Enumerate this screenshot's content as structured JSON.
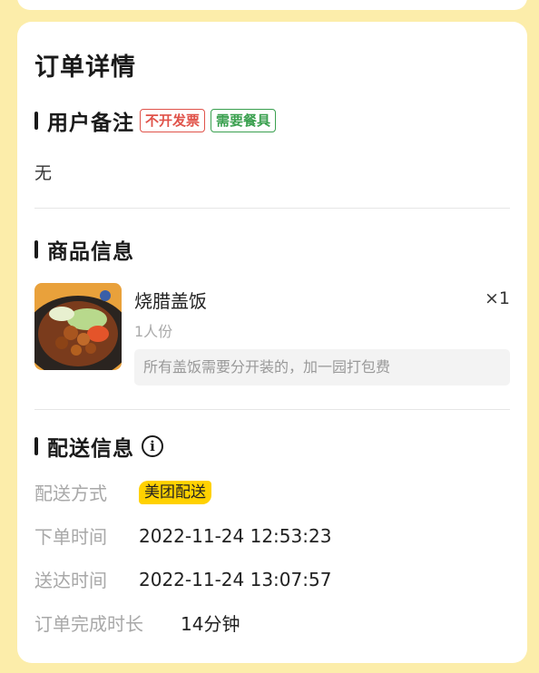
{
  "order": {
    "title": "订单详情",
    "remark_section": {
      "title": "用户备注",
      "tags": [
        {
          "label": "不开发票",
          "color": "#e0534a"
        },
        {
          "label": "需要餐具",
          "color": "#3aa04f"
        }
      ],
      "text": "无"
    },
    "product_section": {
      "title": "商品信息",
      "item": {
        "name": "烧腊盖饭",
        "quantity": "×1",
        "spec": "1人份",
        "remark": "所有盖饭需要分开装的，加一园打包费"
      }
    },
    "delivery_section": {
      "title": "配送信息",
      "info_icon": "info-circle-icon",
      "rows": [
        {
          "label": "配送方式",
          "value": "美团配送"
        },
        {
          "label": "下单时间",
          "value": "2022-11-24 12:53:23"
        },
        {
          "label": "送达时间",
          "value": "2022-11-24 13:07:57"
        },
        {
          "label": "订单完成时长",
          "value": "14分钟"
        }
      ]
    }
  },
  "colors": {
    "background": "#fcedaa",
    "badge": "#ffd100"
  }
}
